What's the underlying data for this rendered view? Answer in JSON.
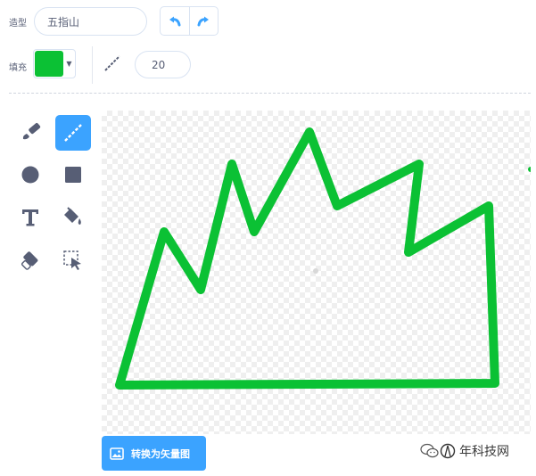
{
  "costume": {
    "label": "造型",
    "name": "五指山"
  },
  "fill": {
    "label": "填充",
    "color": "#0bc134"
  },
  "outline": {
    "width": "20"
  },
  "canvas": {
    "stroke_color": "#0bc134"
  },
  "convert_button": {
    "label": "转换为矢量图"
  },
  "watermark": {
    "text": "年科技网"
  },
  "colors": {
    "accent": "#3ba3ff",
    "icon_gray": "#575e75"
  },
  "tools": [
    {
      "name": "brush",
      "icon": "brush-icon",
      "active": false
    },
    {
      "name": "line",
      "icon": "line-icon",
      "active": true
    },
    {
      "name": "circle",
      "icon": "circle-icon",
      "active": false
    },
    {
      "name": "rectangle",
      "icon": "rectangle-icon",
      "active": false
    },
    {
      "name": "text",
      "icon": "text-icon",
      "active": false
    },
    {
      "name": "fill",
      "icon": "fill-bucket-icon",
      "active": false
    },
    {
      "name": "eraser",
      "icon": "eraser-icon",
      "active": false
    },
    {
      "name": "select",
      "icon": "select-icon",
      "active": false
    }
  ]
}
